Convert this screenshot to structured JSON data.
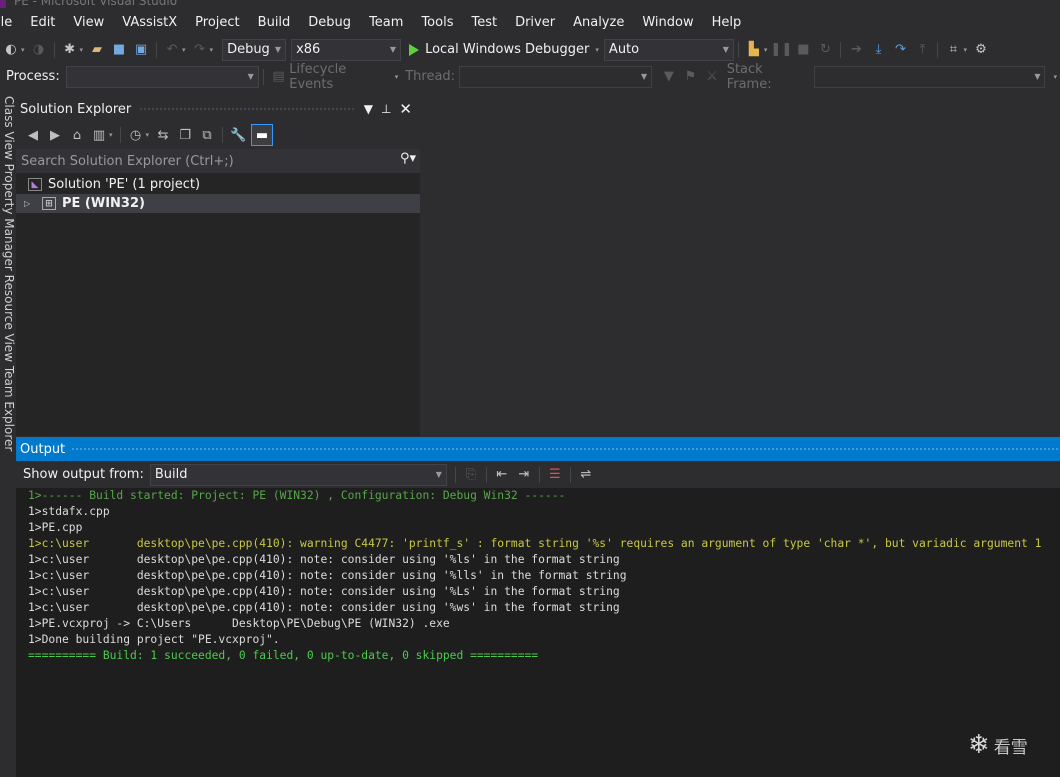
{
  "window": {
    "title": "PE - Microsoft Visual Studio"
  },
  "menu": [
    "ile",
    "Edit",
    "View",
    "VAssistX",
    "Project",
    "Build",
    "Debug",
    "Team",
    "Tools",
    "Test",
    "Driver",
    "Analyze",
    "Window",
    "Help"
  ],
  "toolbar": {
    "configuration": "Debug",
    "platform": "x86",
    "run_label": "Local Windows Debugger",
    "run_mode": "Auto"
  },
  "debug_location": {
    "process_label": "Process:",
    "process_value": "",
    "lifecycle_label": "Lifecycle Events",
    "thread_label": "Thread:",
    "stack_frame_label": "Stack Frame:"
  },
  "left_strip": {
    "text": "Class View  Property Manager  Resource View  Team Explorer"
  },
  "solution_explorer": {
    "title": "Solution Explorer",
    "search_placeholder": "Search Solution Explorer (Ctrl+;)",
    "solution_label": "Solution 'PE' (1 project)",
    "project_label": "PE  (WIN32)"
  },
  "output": {
    "title": "Output",
    "show_from_label": "Show output from:",
    "source": "Build",
    "lines": [
      {
        "text": "1>------ Build started: Project: PE (WIN32) , Configuration: Debug Win32 ------",
        "style": "green"
      },
      {
        "text": "1>stdafx.cpp",
        "style": "plain"
      },
      {
        "text": "1>PE.cpp",
        "style": "plain"
      },
      {
        "text": "1>c:\\user       desktop\\pe\\pe.cpp(410): warning C4477: 'printf_s' : format string '%s' requires an argument of type 'char *', but variadic argument 1",
        "style": "warn"
      },
      {
        "text": "1>c:\\user       desktop\\pe\\pe.cpp(410): note: consider using '%ls' in the format string",
        "style": "plain"
      },
      {
        "text": "1>c:\\user       desktop\\pe\\pe.cpp(410): note: consider using '%lls' in the format string",
        "style": "plain"
      },
      {
        "text": "1>c:\\user       desktop\\pe\\pe.cpp(410): note: consider using '%Ls' in the format string",
        "style": "plain"
      },
      {
        "text": "1>c:\\user       desktop\\pe\\pe.cpp(410): note: consider using '%ws' in the format string",
        "style": "plain"
      },
      {
        "text": "1>PE.vcxproj -> C:\\Users      Desktop\\PE\\Debug\\PE (WIN32) .exe",
        "style": "plain"
      },
      {
        "text": "1>Done building project \"PE.vcxproj\".",
        "style": "plain"
      },
      {
        "text": "========== Build: 1 succeeded, 0 failed, 0 up-to-date, 0 skipped ==========",
        "style": "green2"
      }
    ]
  },
  "watermark": {
    "text": "看雪"
  },
  "colors": {
    "accent": "#007acc",
    "background": "#2d2d30",
    "editor": "#1e1e1e"
  }
}
